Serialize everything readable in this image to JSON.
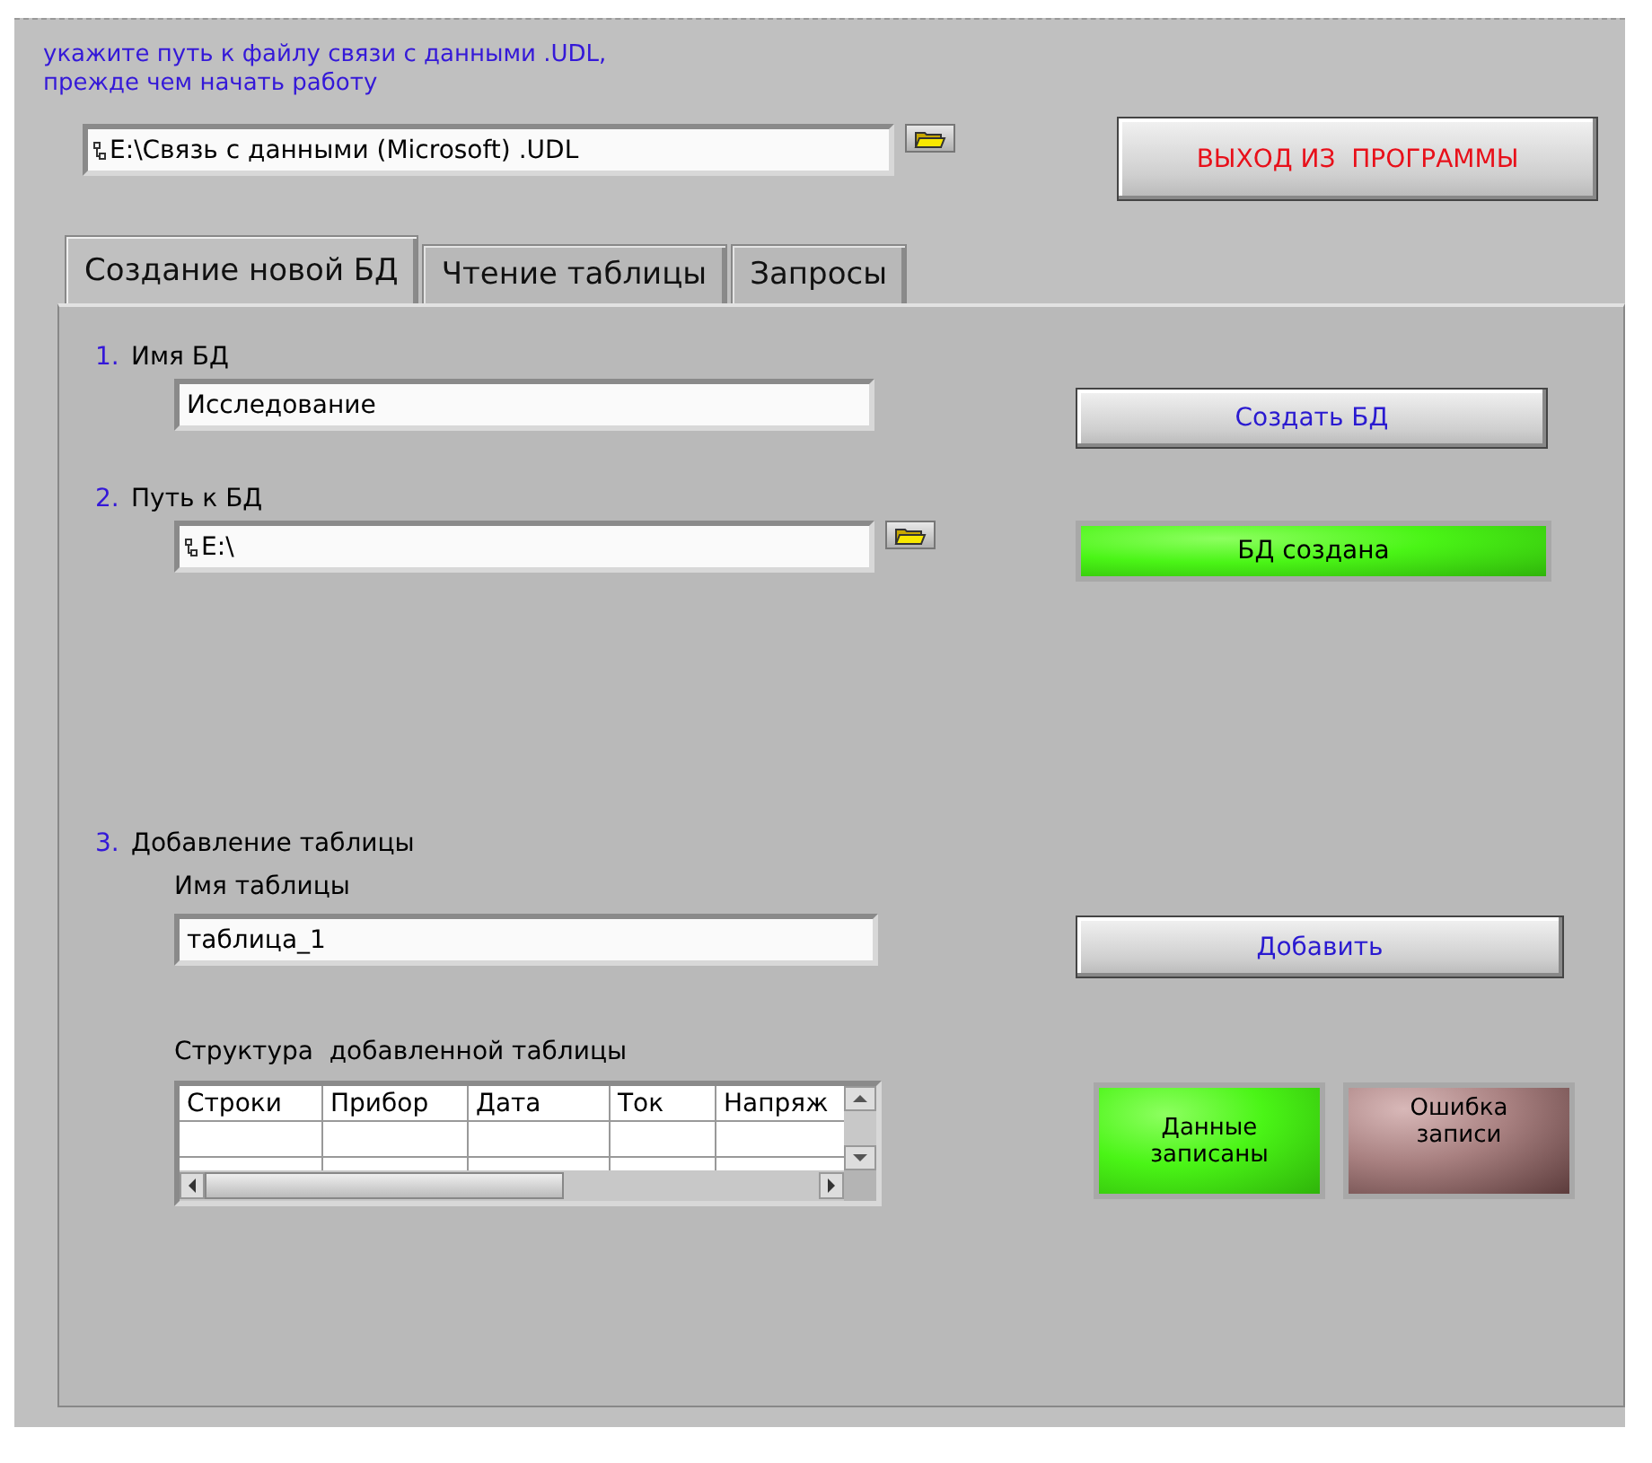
{
  "instruction": "укажите путь к файлу связи с данными .UDL,\nпрежде чем начать работу",
  "udl_path": {
    "value": "E:\\Связь с данными (Microsoft) .UDL"
  },
  "exit_button": {
    "label": "ВЫХОД ИЗ  ПРОГРАММЫ"
  },
  "tabs": [
    {
      "label": "Создание новой БД",
      "selected": true
    },
    {
      "label": "Чтение таблицы",
      "selected": false
    },
    {
      "label": "Запросы",
      "selected": false
    }
  ],
  "create_db": {
    "step_number": "1.",
    "label": "Имя БД",
    "name_field": {
      "value": "Исследование"
    },
    "button": "Создать БД"
  },
  "db_path": {
    "step_number": "2.",
    "label": "Путь к БД",
    "path_field": {
      "value": "E:\\"
    },
    "status_led": {
      "label": "БД создана",
      "on": true
    }
  },
  "add_table": {
    "step_number": "3.",
    "label": "Добавление таблицы",
    "name_label": "Имя таблицы",
    "name_field": {
      "value": "таблица_1"
    },
    "button": "Добавить",
    "structure_label": "Структура  добавленной таблицы",
    "table": {
      "columns": [
        "Строки",
        "Прибор",
        "Дата",
        "Ток",
        "Напряж"
      ]
    },
    "leds": [
      {
        "label": "Данные\nзаписаны",
        "on": true
      },
      {
        "label": "Ошибка\nзаписи",
        "on": false
      }
    ]
  }
}
